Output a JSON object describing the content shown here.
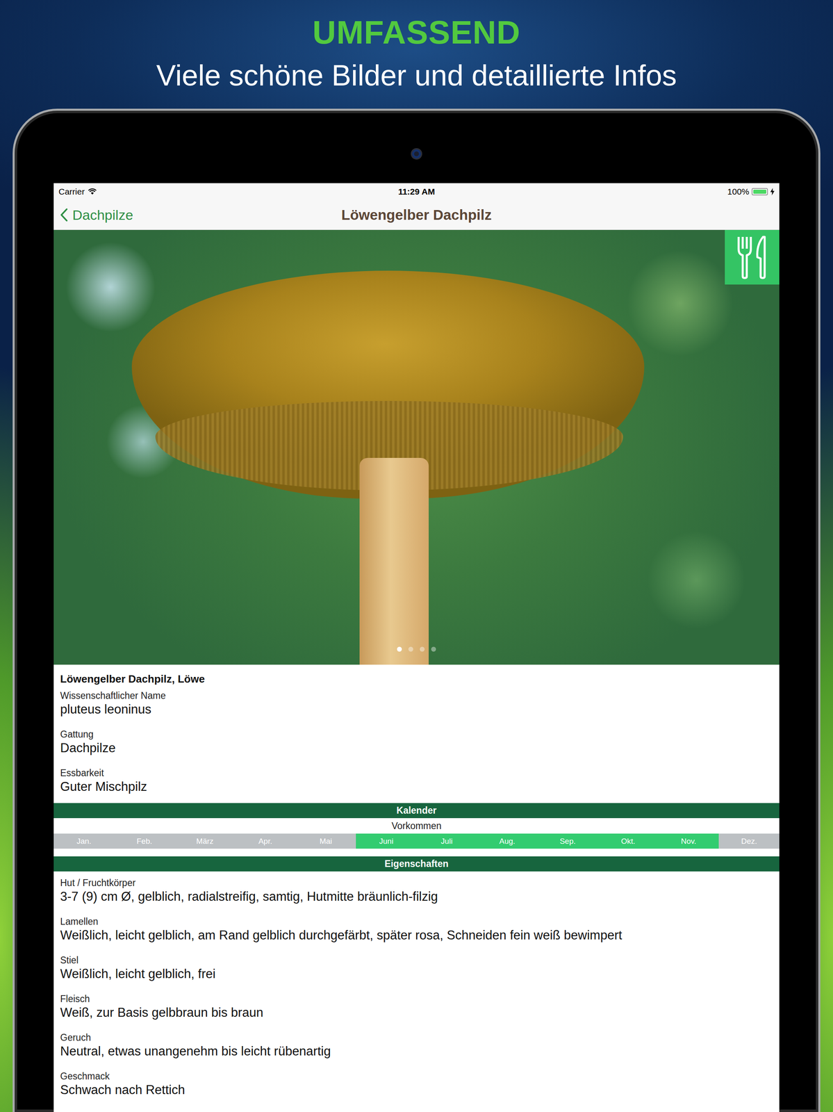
{
  "header": {
    "title": "UMFASSEND",
    "subtitle": "Viele schöne Bilder und detaillierte Infos"
  },
  "status_bar": {
    "carrier": "Carrier",
    "time": "11:29 AM",
    "battery": "100%",
    "battery_level": 1,
    "charging": true
  },
  "nav": {
    "back": "Dachpilze",
    "title": "Löwengelber Dachpilz"
  },
  "photo": {
    "edible": true,
    "pages": [
      {
        "selected": true
      },
      {
        "selected": false
      },
      {
        "selected": false
      },
      {
        "selected": false
      }
    ]
  },
  "info": {
    "name": "Löwengelber Dachpilz, Löwe",
    "fields": [
      {
        "label": "Wissenschaftlicher Name",
        "value": "pluteus leoninus"
      },
      {
        "label": "Gattung",
        "value": "Dachpilze"
      },
      {
        "label": "Essbarkeit",
        "value": "Guter Mischpilz"
      }
    ]
  },
  "calendar": {
    "title": "Kalender",
    "label": "Vorkommen",
    "months": [
      {
        "label": "Jan.",
        "active": false
      },
      {
        "label": "Feb.",
        "active": false
      },
      {
        "label": "März",
        "active": false
      },
      {
        "label": "Apr.",
        "active": false
      },
      {
        "label": "Mai",
        "active": false
      },
      {
        "label": "Juni",
        "active": true
      },
      {
        "label": "Juli",
        "active": true
      },
      {
        "label": "Aug.",
        "active": true
      },
      {
        "label": "Sep.",
        "active": true
      },
      {
        "label": "Okt.",
        "active": true
      },
      {
        "label": "Nov.",
        "active": true
      },
      {
        "label": "Dez.",
        "active": false
      }
    ]
  },
  "properties": {
    "title": "Eigenschaften",
    "fields": [
      {
        "label": "Hut / Fruchtkörper",
        "value": "3-7 (9) cm Ø, gelblich, radialstreifig, samtig, Hutmitte bräunlich-filzig"
      },
      {
        "label": "Lamellen",
        "value": "Weißlich, leicht gelblich, am Rand gelblich durchgefärbt, später rosa, Schneiden fein weiß bewimpert"
      },
      {
        "label": "Stiel",
        "value": "Weißlich, leicht gelblich, frei"
      },
      {
        "label": "Fleisch",
        "value": "Weiß, zur Basis gelbbraun bis braun"
      },
      {
        "label": "Geruch",
        "value": "Neutral, etwas unangenehm bis leicht rübenartig"
      },
      {
        "label": "Geschmack",
        "value": "Schwach nach Rettich"
      }
    ]
  }
}
